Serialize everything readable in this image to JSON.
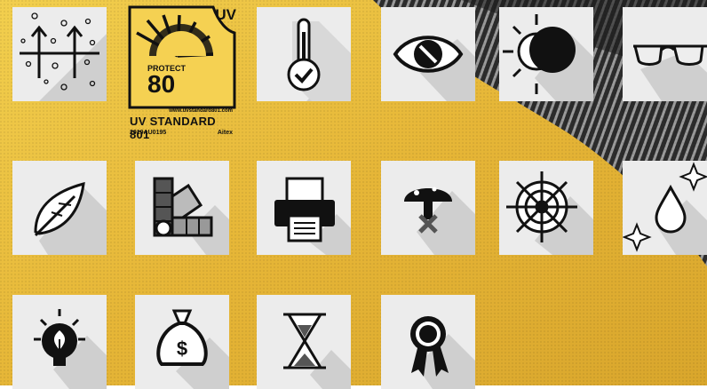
{
  "uv_label": {
    "badge": "UV",
    "protect": "PROTECT",
    "rating": "80",
    "url": "www.uvstandard801.com",
    "standard": "UV STANDARD 801",
    "code": "2019AU0195",
    "lab": "Aitex"
  },
  "icons": [
    {
      "name": "breathable-icon"
    },
    {
      "name": "temperature-check-icon"
    },
    {
      "name": "eye-protection-icon"
    },
    {
      "name": "sun-block-icon"
    },
    {
      "name": "glasses-icon"
    },
    {
      "name": "lightweight-feather-icon"
    },
    {
      "name": "color-swatch-icon"
    },
    {
      "name": "printer-icon"
    },
    {
      "name": "no-mold-icon"
    },
    {
      "name": "ship-wheel-icon"
    },
    {
      "name": "water-drop-sparkle-icon"
    },
    {
      "name": "eco-idea-bulb-icon"
    },
    {
      "name": "money-bag-icon"
    },
    {
      "name": "hourglass-icon"
    },
    {
      "name": "award-badge-icon"
    }
  ],
  "colors": {
    "fabric_yellow": "#e9b937",
    "fabric_stripe": "#3a3a3a",
    "tile_bg": "#ececec",
    "tile_shadow": "#c9c9c9",
    "icon": "#111111"
  }
}
